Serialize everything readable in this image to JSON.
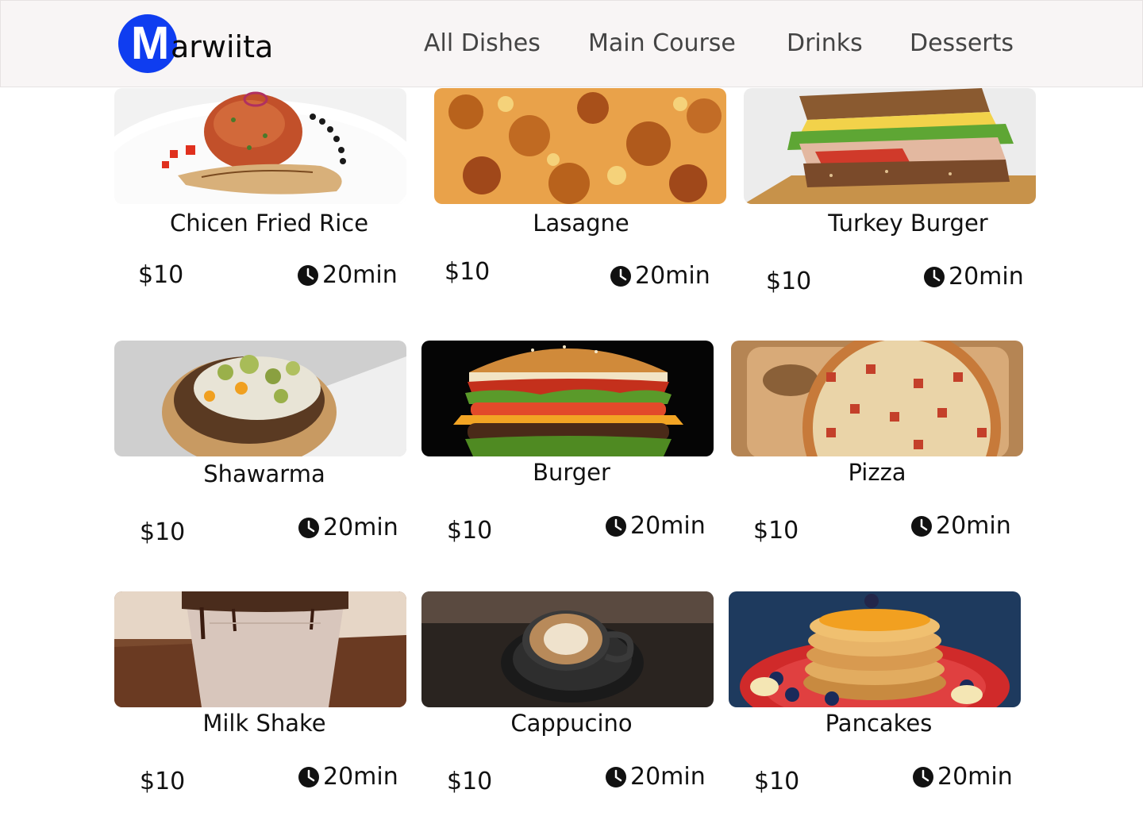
{
  "brand": {
    "letter": "M",
    "rest": "arwiita",
    "badge_color": "#0f3df0"
  },
  "nav": [
    {
      "label": "All Dishes"
    },
    {
      "label": "Main Course"
    },
    {
      "label": "Drinks"
    },
    {
      "label": "Desserts"
    }
  ],
  "dishes": [
    {
      "name": "Chicen Fried Rice",
      "price": "$10",
      "time": "20min",
      "icon": "clock-icon"
    },
    {
      "name": "Lasagne",
      "price": "$10",
      "time": "20min",
      "icon": "clock-icon"
    },
    {
      "name": "Turkey Burger",
      "price": "$10",
      "time": "20min",
      "icon": "clock-icon"
    },
    {
      "name": "Shawarma",
      "price": "$10",
      "time": "20min",
      "icon": "clock-icon"
    },
    {
      "name": "Burger",
      "price": "$10",
      "time": "20min",
      "icon": "clock-icon"
    },
    {
      "name": "Pizza",
      "price": "$10",
      "time": "20min",
      "icon": "clock-icon"
    },
    {
      "name": "Milk Shake",
      "price": "$10",
      "time": "20min",
      "icon": "clock-icon"
    },
    {
      "name": "Cappucino",
      "price": "$10",
      "time": "20min",
      "icon": "clock-icon"
    },
    {
      "name": "Pancakes",
      "price": "$10",
      "time": "20min",
      "icon": "clock-icon"
    }
  ]
}
